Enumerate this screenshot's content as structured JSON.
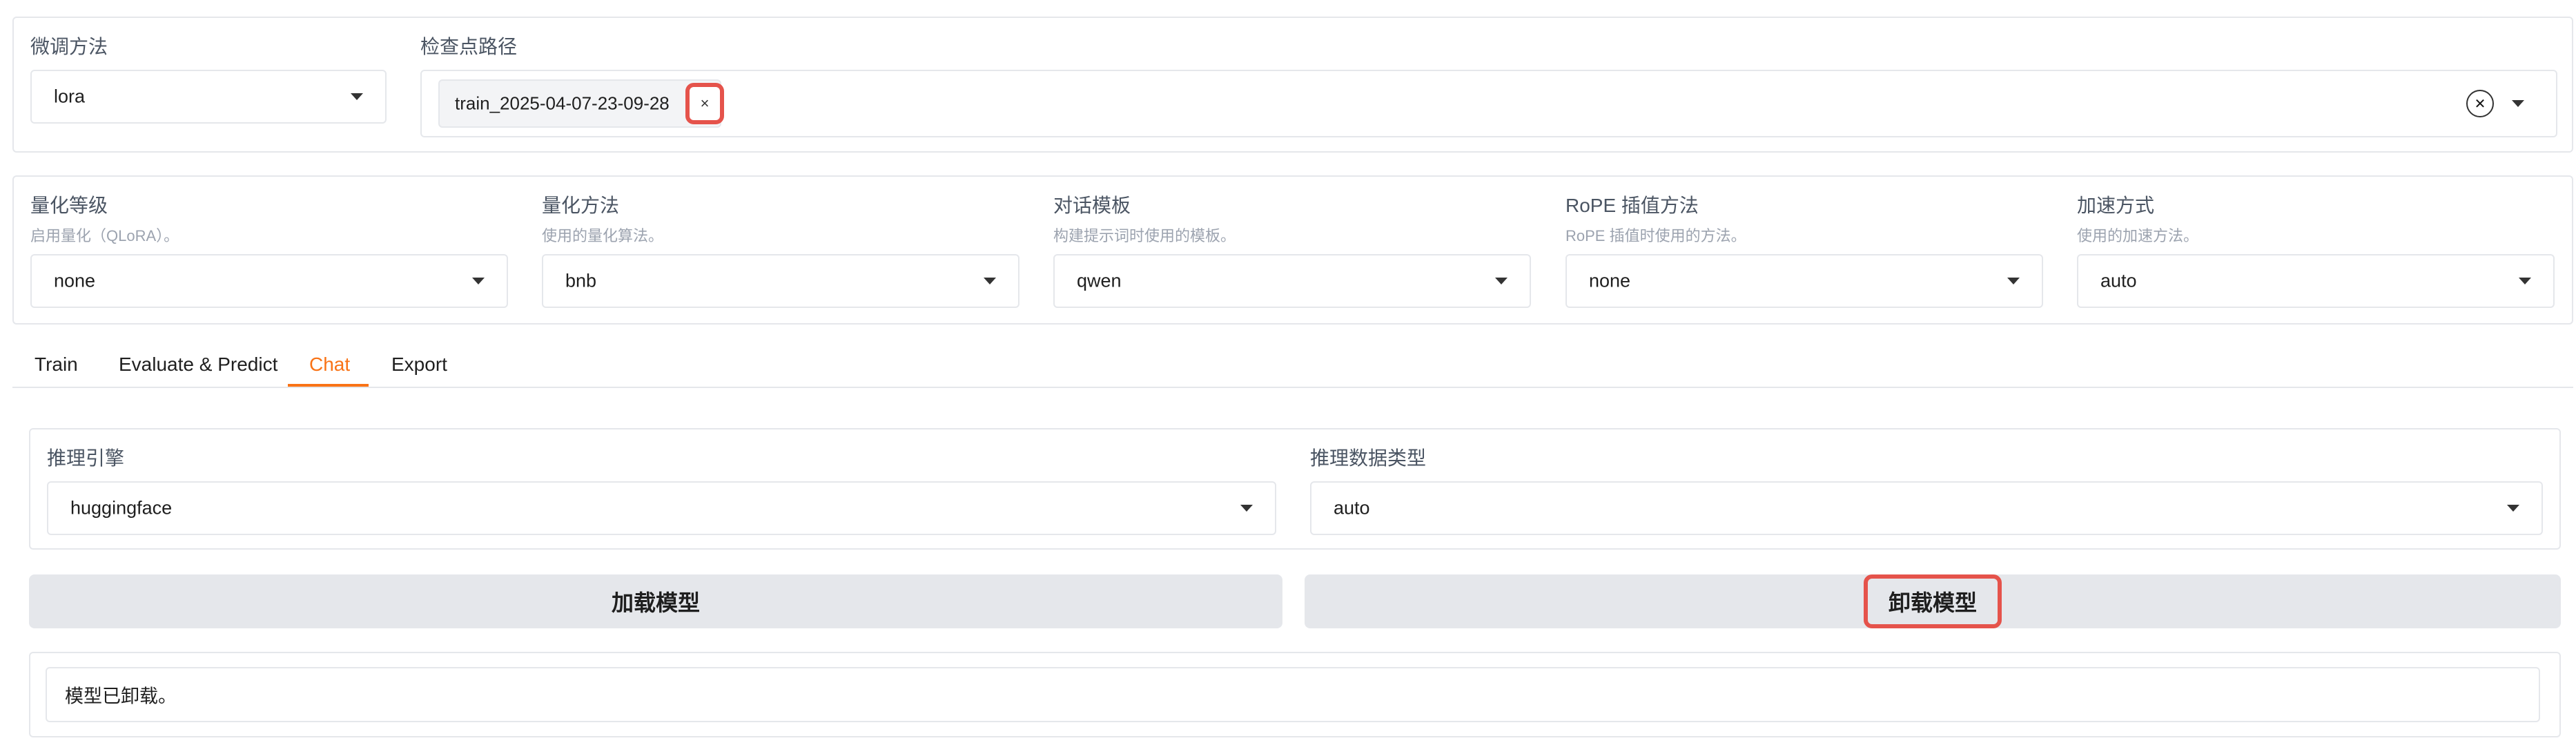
{
  "top": {
    "finetune_label": "微调方法",
    "finetune_value": "lora",
    "checkpoint_label": "检查点路径",
    "checkpoint_chip": "train_2025-04-07-23-09-28",
    "chip_remove_glyph": "×",
    "clear_glyph": "✕"
  },
  "options": [
    {
      "label": "量化等级",
      "hint": "启用量化（QLoRA）。",
      "value": "none"
    },
    {
      "label": "量化方法",
      "hint": "使用的量化算法。",
      "value": "bnb"
    },
    {
      "label": "对话模板",
      "hint": "构建提示词时使用的模板。",
      "value": "qwen"
    },
    {
      "label": "RoPE 插值方法",
      "hint": "RoPE 插值时使用的方法。",
      "value": "none"
    },
    {
      "label": "加速方式",
      "hint": "使用的加速方法。",
      "value": "auto"
    }
  ],
  "tabs": [
    "Train",
    "Evaluate & Predict",
    "Chat",
    "Export"
  ],
  "active_tab": "Chat",
  "chat": {
    "infer_backend_label": "推理引擎",
    "infer_backend_value": "huggingface",
    "infer_dtype_label": "推理数据类型",
    "infer_dtype_value": "auto",
    "load_button": "加载模型",
    "unload_button": "卸载模型",
    "info_text": "模型已卸载。"
  },
  "colors": {
    "accent": "#f97316",
    "highlight": "#e5534b",
    "button_bg": "#e5e7eb",
    "border": "#e5e7eb"
  }
}
